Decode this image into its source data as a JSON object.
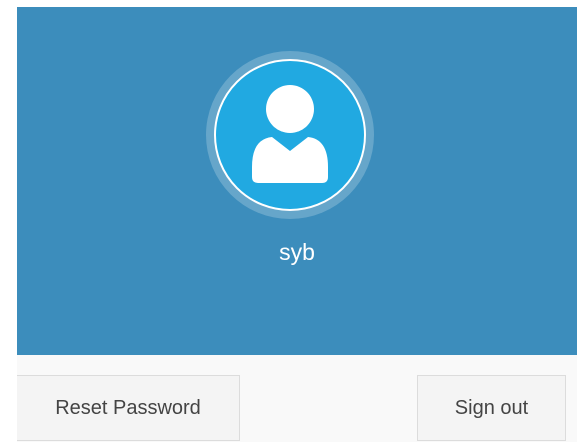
{
  "user": {
    "name": "syb",
    "avatar_icon": "user-avatar-icon"
  },
  "footer": {
    "reset_password_label": "Reset Password",
    "sign_out_label": "Sign out"
  },
  "colors": {
    "header_bg": "#3c8dbc",
    "avatar_bg": "#21a9e1",
    "footer_bg": "#f9f9f9",
    "button_bg": "#f4f4f4"
  }
}
